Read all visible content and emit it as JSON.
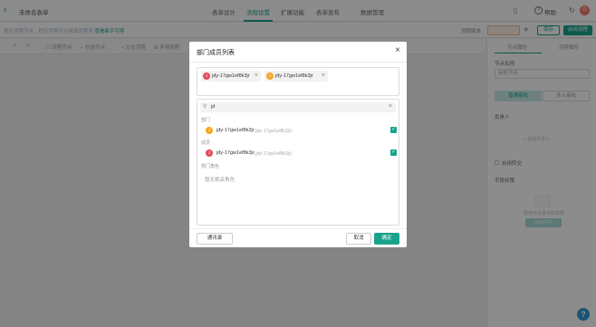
{
  "topbar": {
    "back_icon": "‹",
    "form_title": "未命名表单",
    "tabs": [
      {
        "label": "表单设计",
        "active": false
      },
      {
        "label": "流程设置",
        "active": true
      },
      {
        "label": "扩展功能",
        "active": false
      },
      {
        "label": "表单发布",
        "active": false
      },
      {
        "label": "数据管理",
        "active": false
      }
    ],
    "phone_icon": "▯",
    "help_icon": "?",
    "help_label": "帮助",
    "refresh_icon": "↻",
    "user_avatar_text": "G",
    "accent_color": "#19a38c"
  },
  "subbar": {
    "hint_text": "表达流程节点，把应流程节点组成流程系",
    "hint_link": "查看新手引导",
    "version_label": "流程版本",
    "save_label": "保存",
    "publish_label": "启用流程"
  },
  "toolbar": {
    "undo": "↶",
    "redo": "↷",
    "tools": [
      "流程节点",
      "抄送节点",
      "分支流程",
      "多项流程"
    ]
  },
  "right_panel": {
    "tab_node": "节点属性",
    "tab_flow": "流程属性",
    "node_name_label": "节点名称",
    "node_name_placeholder": "审批节点",
    "seg_a": "普通审批",
    "seg_b": "多人审批",
    "assignee_label": "负责人",
    "add_assignee": "+ 添加负责人",
    "option_label": "启用转交",
    "field_perm_label": "字段权限",
    "field_perm_note": "暂无可设置字段权限",
    "field_perm_button": "添加字段"
  },
  "modal": {
    "title": "部门成员列表",
    "close_icon": "×",
    "selected": [
      {
        "name": "jdy-17gw1ef8k3jr",
        "avatar": "J",
        "color": "#e14d5a"
      },
      {
        "name": "jdy-17gw1ef8k3jr",
        "avatar": "J",
        "color": "#f5a623"
      }
    ],
    "chip_remove": "×",
    "search": {
      "icon": "⚲",
      "value": "jd",
      "clear": "×"
    },
    "sections": {
      "dept": "部门",
      "member": "成员",
      "role": "部门角色"
    },
    "dept_row": {
      "avatar": "J",
      "color": "#f5a623",
      "name": "jdy-17gw1ef8k3jr",
      "sub": "(jdy-17gw1ef8k3jr)",
      "checked": "✓"
    },
    "member_row": {
      "avatar": "J",
      "color": "#e14d5a",
      "name": "jdy-17gw1ef8k3jr",
      "sub": "(jdy-17gw1ef8k3jr)",
      "checked": "✓"
    },
    "role_empty": "暂无相关角色",
    "address_book_button": "通讯录",
    "cancel_button": "取消",
    "confirm_button": "确定"
  },
  "fab": {
    "help_icon": "?"
  }
}
